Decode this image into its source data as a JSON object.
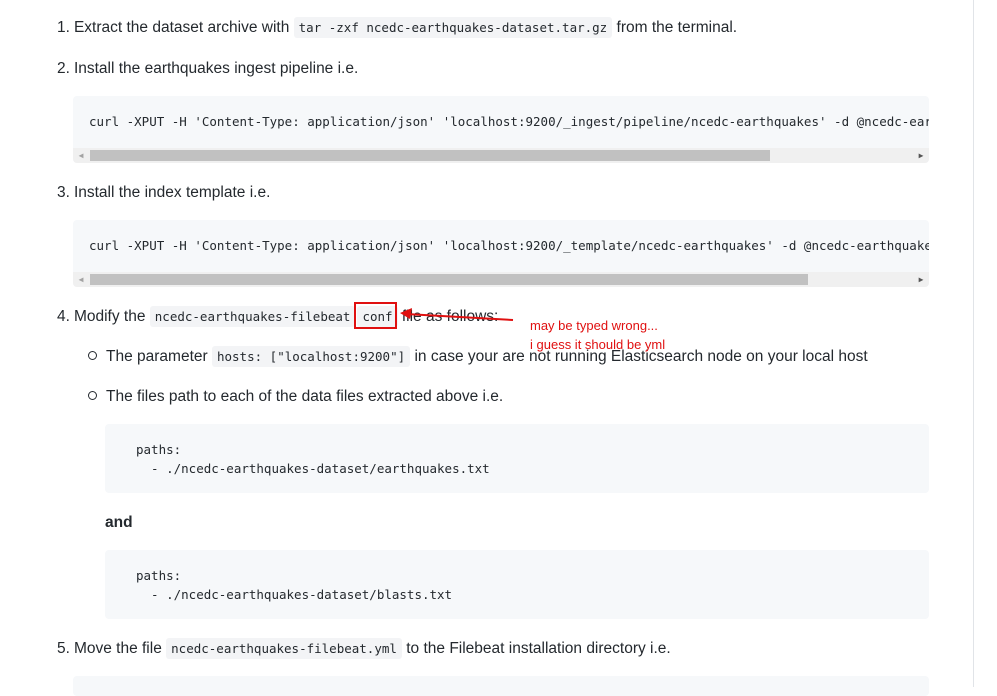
{
  "steps": {
    "s1": {
      "num": "1.",
      "before": "Extract the dataset archive with",
      "code": "tar -zxf ncedc-earthquakes-dataset.tar.gz",
      "after": "from the terminal."
    },
    "s2": {
      "num": "2.",
      "text": "Install the earthquakes ingest pipeline i.e."
    },
    "s2_code": "curl -XPUT -H 'Content-Type: application/json' 'localhost:9200/_ingest/pipeline/ncedc-earthquakes' -d @ncedc-eart",
    "s3": {
      "num": "3.",
      "text": "Install the index template i.e."
    },
    "s3_code": "curl -XPUT -H 'Content-Type: application/json' 'localhost:9200/_template/ncedc-earthquakes' -d @ncedc-earthquakes",
    "s4": {
      "num": "4.",
      "before": "Modify the",
      "code1": "ncedc-earthquakes-filebeat",
      "code2": "conf",
      "after": "file as follows:"
    },
    "s4_b1": {
      "before": "The parameter",
      "code": "hosts: [\"localhost:9200\"]",
      "after": "in case your are not running Elasticsearch node on your local host"
    },
    "s4_b2": {
      "text": "The files path to each of the data files extracted above i.e."
    },
    "block1": {
      "line1": "paths:",
      "line2": "  - ./ncedc-earthquakes-dataset/earthquakes.txt"
    },
    "and_label": "and",
    "block2": {
      "line1": "paths:",
      "line2": "  - ./ncedc-earthquakes-dataset/blasts.txt"
    },
    "s5": {
      "num": "5.",
      "before": "Move the file",
      "code": "ncedc-earthquakes-filebeat.yml",
      "after": "to the Filebeat installation directory i.e."
    }
  },
  "annotation": {
    "line1": "may be typed wrong...",
    "line2": "i guess it should be yml",
    "color": "#e01010"
  },
  "scrollbar": {
    "left_arrow": "◀",
    "right_arrow": "▶"
  }
}
